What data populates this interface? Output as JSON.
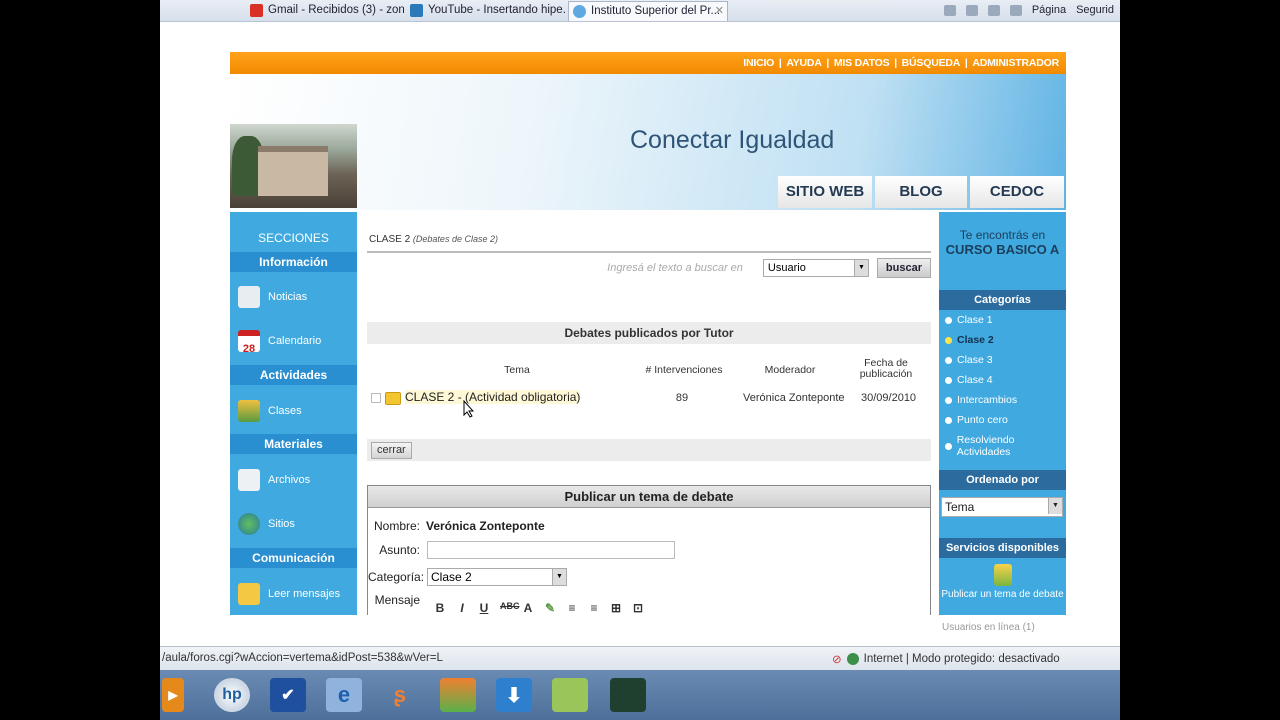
{
  "browser": {
    "tabs": [
      {
        "label": "Gmail - Recibidos (3) - zon...",
        "color": "#d93025"
      },
      {
        "label": "YouTube - Insertando hipe...",
        "color": "#d93025"
      },
      {
        "label": "Instituto Superior del Pr...",
        "color": "#2a7ab9",
        "active": true
      }
    ],
    "command_bar": {
      "page": "Página",
      "security": "Segurid"
    },
    "status_url": "/aula/foros.cgi?wAccion=vertema&idPost=538&wVer=L",
    "zone": "Internet | Modo protegido: desactivado"
  },
  "header": {
    "nav": [
      "INICIO",
      "AYUDA",
      "MIS DATOS",
      "BÚSQUEDA",
      "ADMINISTRADOR"
    ],
    "separator": "|",
    "site_title": "Conectar Igualdad",
    "tabs": [
      "SITIO WEB",
      "BLOG",
      "CEDOC"
    ]
  },
  "left_sidebar": {
    "sections": [
      {
        "heading": "SECCIONES\nInformación",
        "items": [
          "Noticias",
          "Calendario"
        ]
      },
      {
        "heading": "Actividades",
        "items": [
          "Clases"
        ]
      },
      {
        "heading": "Materiales",
        "items": [
          "Archivos",
          "Sitios"
        ]
      },
      {
        "heading": "Comunicación",
        "items": [
          "Leer mensajes"
        ]
      }
    ],
    "heading_top": "SECCIONES",
    "heading_info": "Información",
    "calendar_day": "28"
  },
  "main": {
    "breadcrumb": "CLASE 2",
    "breadcrumb_sub": "(Debates de Clase 2)",
    "search_hint": "Ingresá el texto a buscar en",
    "search_select": "Usuario",
    "search_button": "buscar",
    "debates_heading": "Debates publicados por Tutor",
    "columns": {
      "tema": "Tema",
      "intervenciones": "# Intervenciones",
      "moderador": "Moderador",
      "fecha_line1": "Fecha de",
      "fecha_line2": "publicación"
    },
    "rows": [
      {
        "tema": "CLASE 2 - (Actividad obligatoria)",
        "intervenciones": "89",
        "moderador": "Verónica Zontepontе",
        "fecha": "30/09/2010"
      }
    ],
    "close_button": "cerrar",
    "publish": {
      "heading": "Publicar un tema de debate",
      "nombre_label": "Nombre:",
      "nombre_value": "Verónica Zonteponte",
      "asunto_label": "Asunto:",
      "asunto_value": "",
      "categoria_label": "Categoría:",
      "categoria_value": "Clase 2",
      "mensaje_label": "Mensaje",
      "toolbar": [
        "B",
        "I",
        "U",
        "ABC",
        "A",
        "✎",
        "≡",
        "≡",
        "⊞",
        "⊡"
      ]
    }
  },
  "right_sidebar": {
    "where_line1": "Te encontrás en",
    "where_line2": "CURSO BASICO A",
    "categories_heading": "Categorías",
    "categories": [
      "Clase 1",
      "Clase 2",
      "Clase 3",
      "Clase 4",
      "Intercambios",
      "Punto cero",
      "Resolviendo Actividades"
    ],
    "selected_category": "Clase 2",
    "order_heading": "Ordenado por",
    "order_value": "Tema",
    "services_heading": "Servicios disponibles",
    "services_item": "Publicar un tema de debate",
    "online": "Usuarios en línea (1)"
  }
}
